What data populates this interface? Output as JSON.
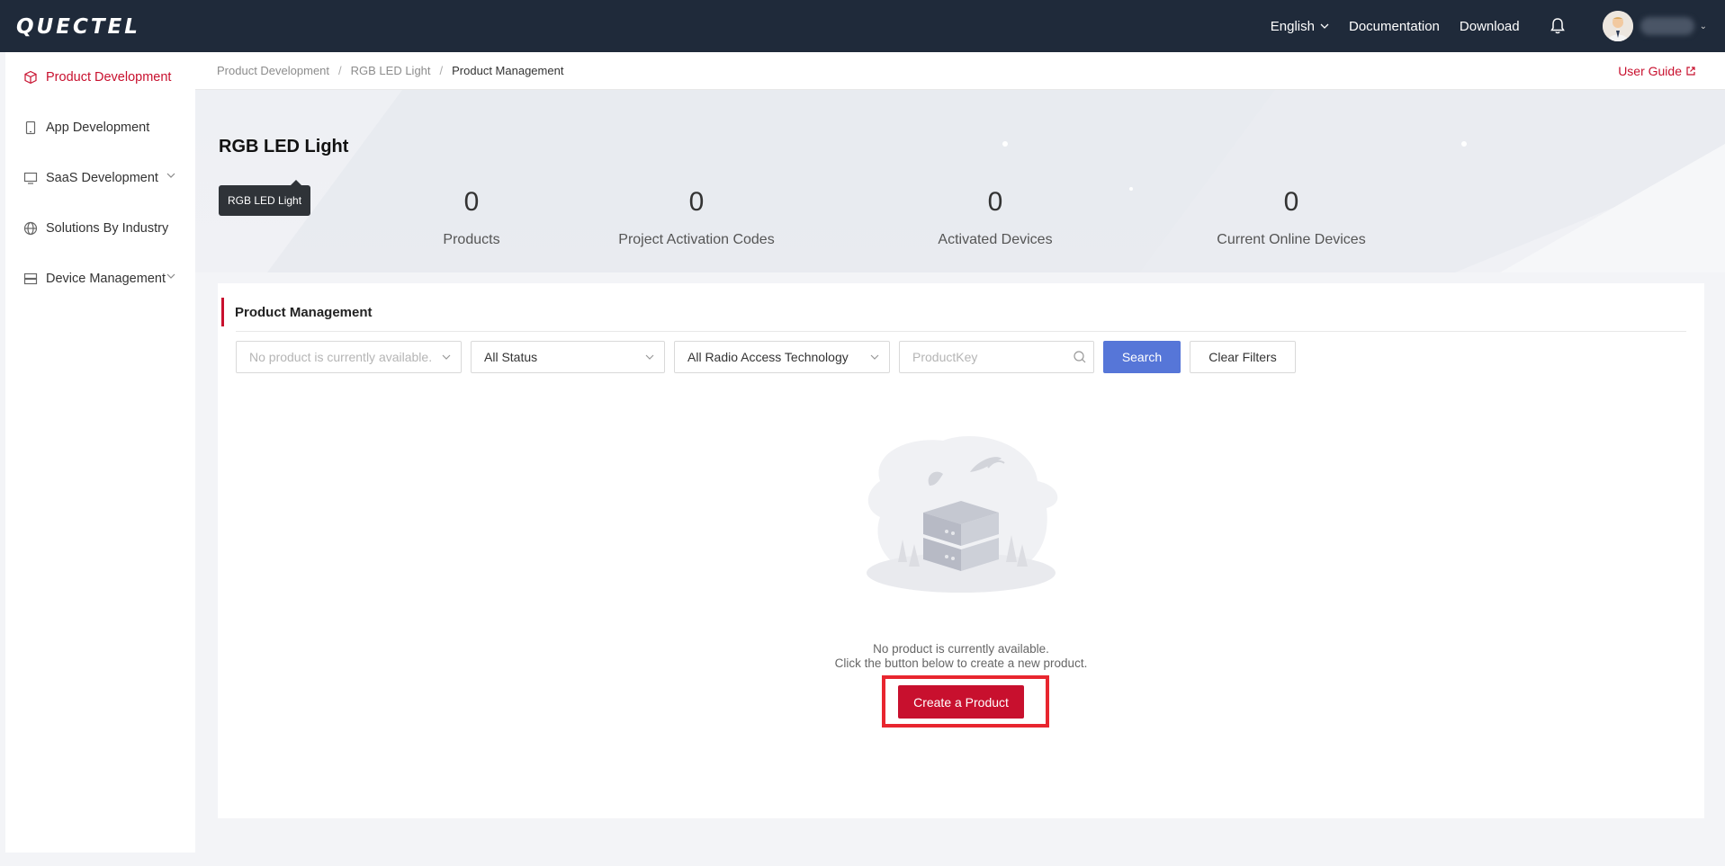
{
  "brand": {
    "logo_text": "QUECTEL"
  },
  "topnav": {
    "language": "English",
    "documentation": "Documentation",
    "download": "Download"
  },
  "sidebar": {
    "items": [
      {
        "label": "Product Development",
        "icon": "cube-icon",
        "active": true,
        "expandable": false
      },
      {
        "label": "App Development",
        "icon": "phone-icon",
        "active": false,
        "expandable": false
      },
      {
        "label": "SaaS Development",
        "icon": "monitor-icon",
        "active": false,
        "expandable": true
      },
      {
        "label": "Solutions By Industry",
        "icon": "globe-icon",
        "active": false,
        "expandable": false
      },
      {
        "label": "Device Management",
        "icon": "server-icon",
        "active": false,
        "expandable": true
      }
    ]
  },
  "breadcrumb": [
    "Product Development",
    "RGB LED Light",
    "Product Management"
  ],
  "user_guide": "User Guide",
  "banner": {
    "title": "RGB LED Light",
    "tooltip": "RGB LED Light",
    "stats": [
      {
        "value": "0",
        "label": "Products"
      },
      {
        "value": "0",
        "label": "Project Activation Codes"
      },
      {
        "value": "0",
        "label": "Activated Devices"
      },
      {
        "value": "0",
        "label": "Current Online Devices"
      }
    ]
  },
  "management": {
    "title": "Product Management",
    "filters": {
      "product_placeholder": "No product is currently available.",
      "status": "All Status",
      "rat": "All Radio Access Technology",
      "productkey_placeholder": "ProductKey",
      "search_label": "Search",
      "clear_label": "Clear Filters"
    },
    "empty": {
      "line1": "No product is currently available.",
      "line2": "Click the button below to create a new product.",
      "create_label": "Create a Product"
    }
  },
  "colors": {
    "brand": "#c8102e",
    "topbar": "#1f2a3a",
    "search_button": "#5676d8",
    "highlight": "#e8262f"
  }
}
